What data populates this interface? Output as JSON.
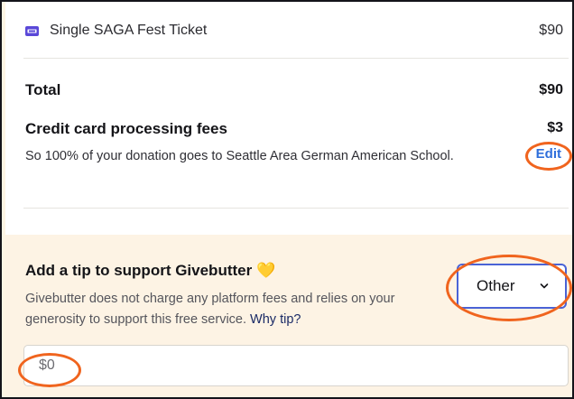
{
  "order": {
    "ticket": {
      "icon": "ticket-icon",
      "name": "Single SAGA Fest Ticket",
      "price": "$90"
    },
    "total": {
      "label": "Total",
      "value": "$90"
    },
    "fees": {
      "title": "Credit card processing fees",
      "amount": "$3",
      "description": "So 100% of your donation goes to Seattle Area German American School.",
      "edit_label": "Edit"
    }
  },
  "tip": {
    "title": "Add a tip to support Givebutter",
    "emoji": "💛",
    "description": "Givebutter does not charge any platform fees and relies on your generosity to support this free service.",
    "why_link": "Why tip?",
    "select_value": "Other",
    "input_placeholder": "$0"
  },
  "colors": {
    "accent": "#2f6fdb",
    "select_border": "#4a63d6",
    "tip_background": "#fdf3e4",
    "annotation": "#f0641e"
  }
}
